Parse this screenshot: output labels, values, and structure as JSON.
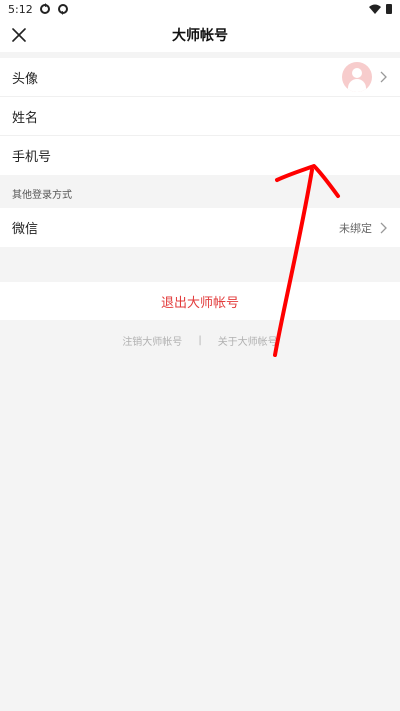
{
  "status_bar": {
    "time": "5:12"
  },
  "header": {
    "title": "大师帐号"
  },
  "profile": {
    "avatar_label": "头像",
    "name_label": "姓名",
    "phone_label": "手机号"
  },
  "other_login": {
    "section_title": "其他登录方式",
    "wechat_label": "微信",
    "wechat_status": "未绑定"
  },
  "logout_label": "退出大师帐号",
  "footer": {
    "cancel_account": "注销大师帐号",
    "separator": "|",
    "about": "关于大师帐号"
  },
  "colors": {
    "accent_red": "#e23b3b",
    "background": "#f4f4f4",
    "annotation_arrow": "#ff0000"
  },
  "icons": [
    "sync-icon",
    "wifi-icon",
    "battery-icon",
    "close-icon",
    "chevron-right-icon",
    "avatar-placeholder-icon"
  ]
}
